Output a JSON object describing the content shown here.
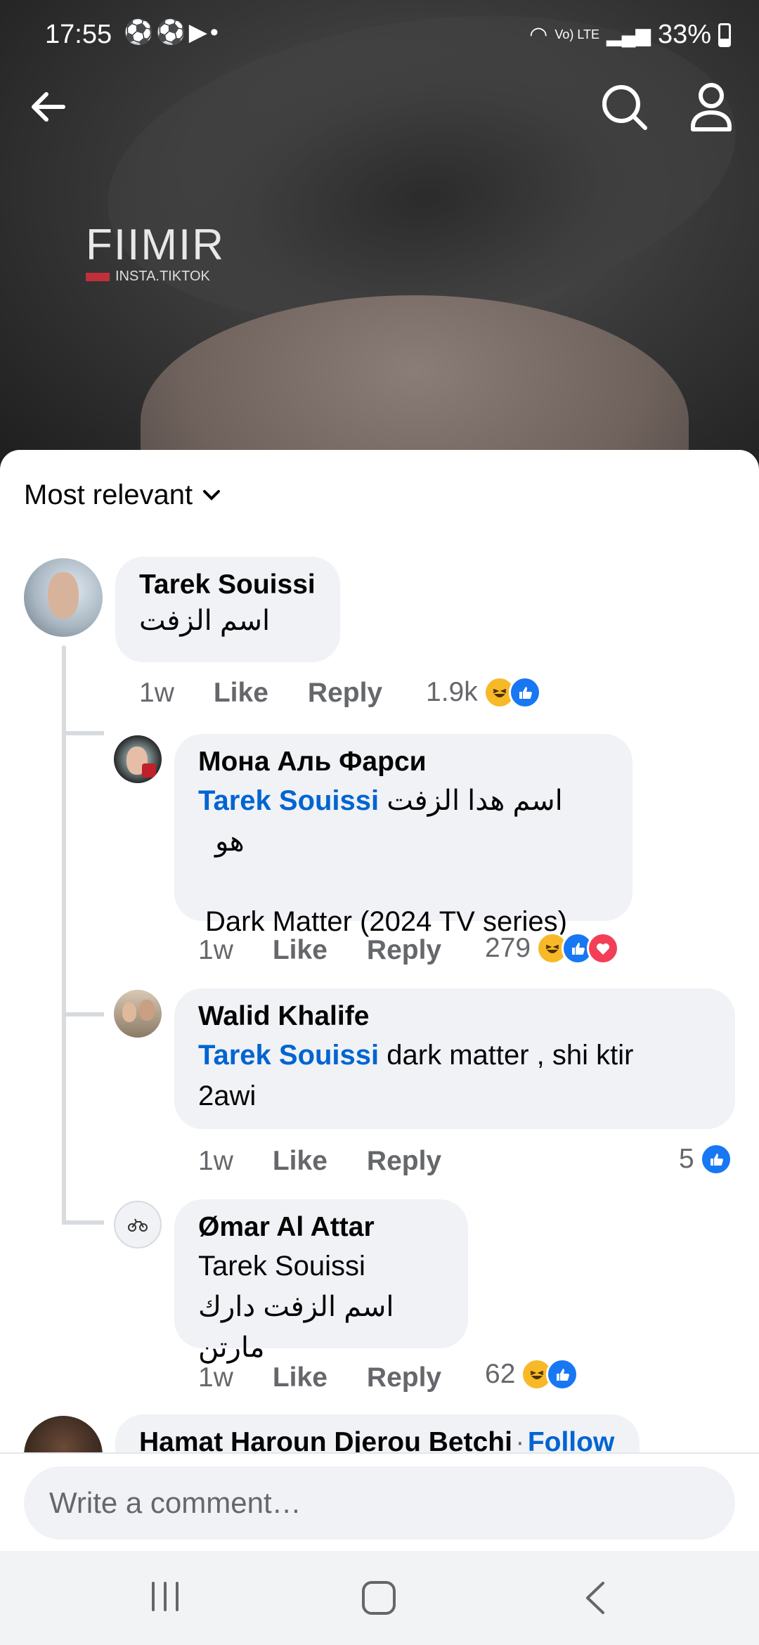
{
  "status_bar": {
    "time": "17:55",
    "notification_icons": [
      "soccer-icon",
      "soccer-icon",
      "youtube-icon",
      "dot"
    ],
    "network": "Vo) LTE",
    "battery": "33%"
  },
  "header": {
    "back_icon": "arrow-left-icon",
    "search_icon": "search-icon",
    "profile_icon": "person-icon"
  },
  "video": {
    "watermark_title": "FIIMIR",
    "watermark_sub": "INSTA.TIKTOK"
  },
  "sort": {
    "label": "Most relevant"
  },
  "comments": [
    {
      "author": "Tarek Souissi",
      "text": "اسم الزفت",
      "time": "1w",
      "like": "Like",
      "reply": "Reply",
      "count": "1.9k",
      "reactions": [
        "haha",
        "like"
      ]
    },
    {
      "author": "Мона Аль Фарси",
      "mention": "Tarek Souissi",
      "text_line1": "اسم هدا الزفت هو",
      "text_line2": "Dark Matter (2024 TV series)",
      "time": "1w",
      "like": "Like",
      "reply": "Reply",
      "count": "279",
      "reactions": [
        "haha",
        "like",
        "love"
      ]
    },
    {
      "author": "Walid Khalife",
      "mention": "Tarek Souissi",
      "text_line1": " dark matter , shi ktir",
      "text_line2": "2awi",
      "time": "1w",
      "like": "Like",
      "reply": "Reply",
      "count": "5",
      "reactions": [
        "like"
      ]
    },
    {
      "author": "Ømar Al Attar",
      "text_line1": "Tarek Souissi",
      "text_line2": "اسم الزفت دارك مارتن",
      "time": "1w",
      "like": "Like",
      "reply": "Reply",
      "count": "62",
      "reactions": [
        "haha",
        "like"
      ]
    },
    {
      "author": "Hamat Haroun Djerou Betchi",
      "separator": "·",
      "follow": "Follow"
    }
  ],
  "input": {
    "placeholder": "Write a comment…"
  },
  "colors": {
    "mention": "#0064d1",
    "bubble": "#f0f2f5",
    "like": "#1877f2",
    "love": "#f33e58",
    "haha": "#f7b928"
  }
}
